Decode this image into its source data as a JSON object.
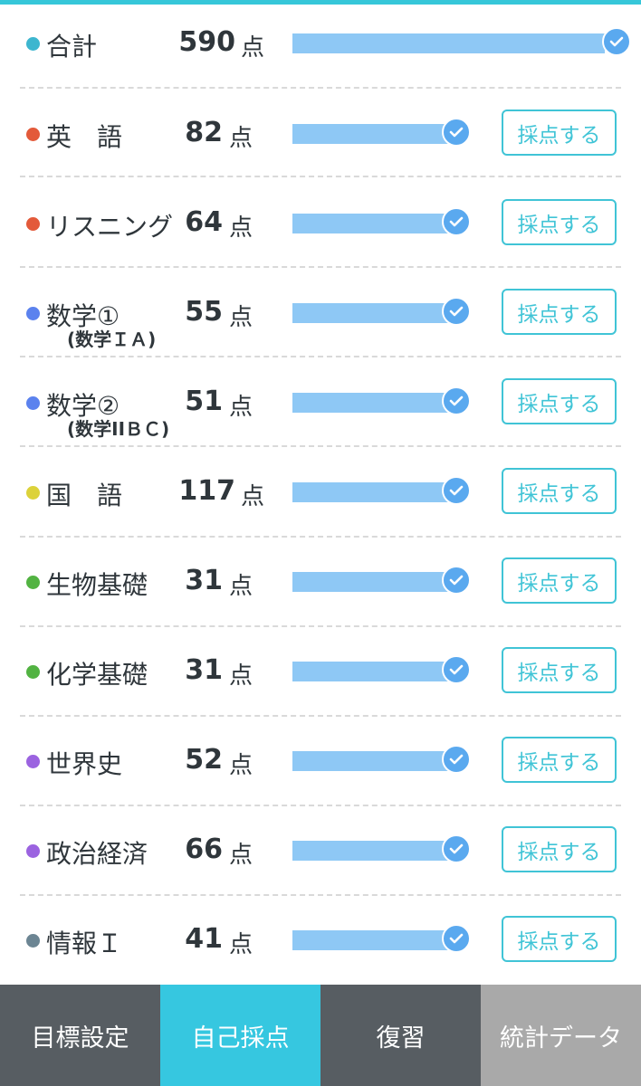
{
  "total": {
    "label": "合計",
    "score": "590",
    "unit": "点",
    "color": "#3db6cf"
  },
  "rows": [
    {
      "label": "英　語",
      "sub": "",
      "score": "82",
      "unit": "点",
      "color": "#e35a3a",
      "button": "採点する"
    },
    {
      "label": "リスニング",
      "sub": "",
      "score": "64",
      "unit": "点",
      "color": "#e35a3a",
      "button": "採点する"
    },
    {
      "label": "数学①",
      "sub": "(数学ＩＡ)",
      "score": "55",
      "unit": "点",
      "color": "#5b82ee",
      "button": "採点する"
    },
    {
      "label": "数学②",
      "sub": "(数学IIＢＣ)",
      "score": "51",
      "unit": "点",
      "color": "#5b82ee",
      "button": "採点する"
    },
    {
      "label": "国　語",
      "sub": "",
      "score": "117",
      "unit": "点",
      "color": "#dcd23a",
      "button": "採点する"
    },
    {
      "label": "生物基礎",
      "sub": "",
      "score": "31",
      "unit": "点",
      "color": "#52b342",
      "button": "採点する"
    },
    {
      "label": "化学基礎",
      "sub": "",
      "score": "31",
      "unit": "点",
      "color": "#52b342",
      "button": "採点する"
    },
    {
      "label": "世界史",
      "sub": "",
      "score": "52",
      "unit": "点",
      "color": "#9b63e0",
      "button": "採点する"
    },
    {
      "label": "政治経済",
      "sub": "",
      "score": "66",
      "unit": "点",
      "color": "#9b63e0",
      "button": "採点する"
    },
    {
      "label": "情報Ｉ",
      "sub": "",
      "score": "41",
      "unit": "点",
      "color": "#6c8593",
      "button": "採点する"
    }
  ],
  "progress": {
    "total": 1.0,
    "subjects": 1.0
  },
  "tabs": [
    {
      "label": "目標設定",
      "state": "normal"
    },
    {
      "label": "自己採点",
      "state": "active"
    },
    {
      "label": "復習",
      "state": "normal"
    },
    {
      "label": "統計データ",
      "state": "disabled"
    }
  ],
  "colors": {
    "accent": "#36c7e0",
    "bar": "#8ec8f5",
    "check": "#5aa9ef",
    "tabbar": "#575d62"
  }
}
